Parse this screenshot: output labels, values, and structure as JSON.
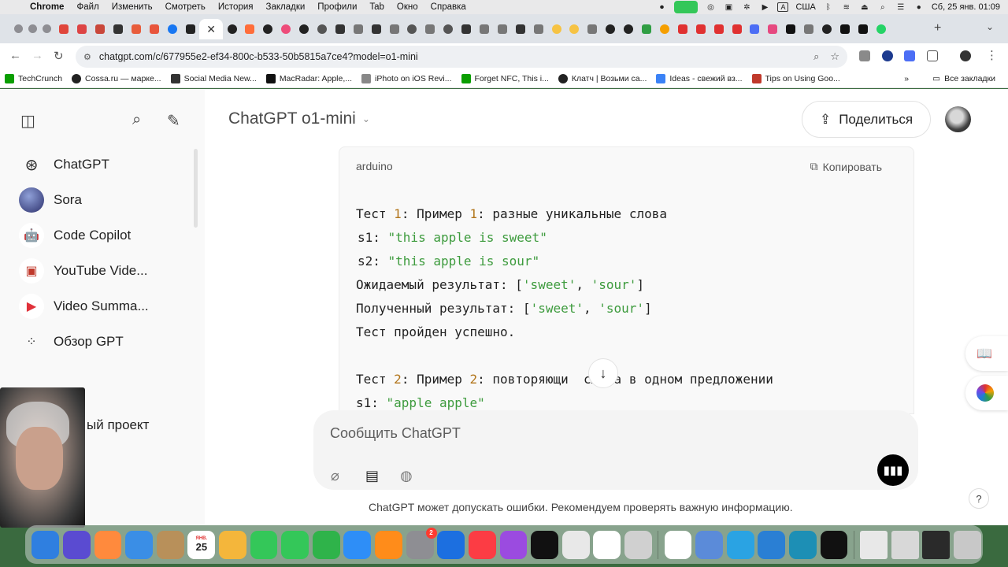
{
  "menubar": {
    "items": [
      "Chrome",
      "Файл",
      "Изменить",
      "Смотреть",
      "История",
      "Закладки",
      "Профили",
      "Tab",
      "Окно",
      "Справка"
    ],
    "input_lang": "США",
    "datetime": "Сб, 25 янв.  01:09"
  },
  "browser": {
    "url": "chatgpt.com/c/677955e2-ef34-800c-b533-50b5815a7ce4?model=o1-mini",
    "active_tab_close": "✕",
    "bookmarks": [
      {
        "label": "TechCrunch",
        "color": "#0a9e01"
      },
      {
        "label": "Cossa.ru — марке...",
        "color": "#222222"
      },
      {
        "label": "Social Media New...",
        "color": "#333333"
      },
      {
        "label": "MacRadar: Apple,...",
        "color": "#111111"
      },
      {
        "label": "iPhoto on iOS Revi...",
        "color": "#888888"
      },
      {
        "label": "Forget NFC, This i...",
        "color": "#0a9e01"
      },
      {
        "label": "Клатч | Возьми са...",
        "color": "#222222"
      },
      {
        "label": "Ideas - свежий вз...",
        "color": "#3b82f6"
      },
      {
        "label": "Tips on Using Goo...",
        "color": "#c0392b"
      }
    ],
    "all_bookmarks": "Все закладки"
  },
  "sidebar": {
    "items": [
      {
        "label": "ChatGPT",
        "icon": "openai-icon"
      },
      {
        "label": "Sora",
        "icon": "sora-avatar"
      },
      {
        "label": "Code Copilot",
        "icon": "robot-avatar"
      },
      {
        "label": "YouTube Vide...",
        "icon": "youtube-video-avatar"
      },
      {
        "label": "Video Summa...",
        "icon": "video-summary-avatar"
      },
      {
        "label": "Обзор GPT",
        "icon": "grid-icon"
      }
    ],
    "project_partial": "ый проект"
  },
  "header": {
    "model": "ChatGPT o1-mini",
    "share_label": "Поделиться"
  },
  "code": {
    "language": "arduino",
    "copy_label": "Копировать",
    "lines": [
      [
        {
          "t": "Тест ",
          "c": ""
        },
        {
          "t": "1",
          "c": "n"
        },
        {
          "t": ": Пример ",
          "c": ""
        },
        {
          "t": "1",
          "c": "n"
        },
        {
          "t": ": разные уникальные слова",
          "c": ""
        }
      ],
      [
        {
          "t": "s1: ",
          "c": ""
        },
        {
          "t": "\"this apple is sweet\"",
          "c": "s"
        }
      ],
      [
        {
          "t": "s2: ",
          "c": ""
        },
        {
          "t": "\"this apple is sour\"",
          "c": "s"
        }
      ],
      [
        {
          "t": "Ожидаемый результат: [",
          "c": ""
        },
        {
          "t": "'sweet'",
          "c": "s"
        },
        {
          "t": ", ",
          "c": ""
        },
        {
          "t": "'sour'",
          "c": "s"
        },
        {
          "t": "]",
          "c": ""
        }
      ],
      [
        {
          "t": "Полученный результат: [",
          "c": ""
        },
        {
          "t": "'sweet'",
          "c": "s"
        },
        {
          "t": ", ",
          "c": ""
        },
        {
          "t": "'sour'",
          "c": "s"
        },
        {
          "t": "]",
          "c": ""
        }
      ],
      [
        {
          "t": "Тест пройден успешно.",
          "c": ""
        }
      ],
      [
        {
          "t": "",
          "c": ""
        }
      ],
      [
        {
          "t": "Тест ",
          "c": ""
        },
        {
          "t": "2",
          "c": "n"
        },
        {
          "t": ": Пример ",
          "c": ""
        },
        {
          "t": "2",
          "c": "n"
        },
        {
          "t": ": повторяющи",
          "c": ""
        },
        {
          "t": "е",
          "c": "hidden"
        },
        {
          "t": " слова в одном предложении",
          "c": ""
        }
      ],
      [
        {
          "t": "s1: ",
          "c": ""
        },
        {
          "t": "\"apple apple\"",
          "c": "s"
        }
      ]
    ]
  },
  "composer": {
    "placeholder": "Сообщить ChatGPT"
  },
  "footer": {
    "disclaimer": "ChatGPT может допускать ошибки. Рекомендуем проверять важную информацию.",
    "help": "?"
  },
  "dock": {
    "calendar_day": "25",
    "calendar_month": "ЯНВ.",
    "settings_badge": "2",
    "apps": [
      {
        "name": "finder",
        "color": "#2f7fe0"
      },
      {
        "name": "siri",
        "color": "#5a4bd1"
      },
      {
        "name": "launchpad",
        "color": "#ff8a3d"
      },
      {
        "name": "mail",
        "color": "#3a8ee6"
      },
      {
        "name": "notes-brown",
        "color": "#b8905a"
      },
      {
        "name": "calendar",
        "color": "#ffffff"
      },
      {
        "name": "photos",
        "color": "#f4b63b"
      },
      {
        "name": "facetime",
        "color": "#34c759"
      },
      {
        "name": "messages",
        "color": "#34c759"
      },
      {
        "name": "numbers",
        "color": "#2fb34a"
      },
      {
        "name": "keynote",
        "color": "#2e8ef7"
      },
      {
        "name": "books",
        "color": "#ff8c1a"
      },
      {
        "name": "system-settings",
        "color": "#8e8e93"
      },
      {
        "name": "safari-like",
        "color": "#1c6fe0"
      },
      {
        "name": "music",
        "color": "#fc3c44"
      },
      {
        "name": "podcasts",
        "color": "#9b4be0"
      },
      {
        "name": "tv",
        "color": "#111111"
      },
      {
        "name": "textedit",
        "color": "#e8e8e8"
      },
      {
        "name": "freeform",
        "color": "#ffffff"
      },
      {
        "name": "iphone-mirroring",
        "color": "#d0d0d0"
      },
      {
        "name": "chrome",
        "color": "#ffffff"
      },
      {
        "name": "preview",
        "color": "#5b8bd9"
      },
      {
        "name": "telegram",
        "color": "#2aa3e3"
      },
      {
        "name": "vscode",
        "color": "#2a7fd4"
      },
      {
        "name": "nexus",
        "color": "#1d8fb5"
      },
      {
        "name": "epic-games",
        "color": "#111111"
      }
    ]
  }
}
